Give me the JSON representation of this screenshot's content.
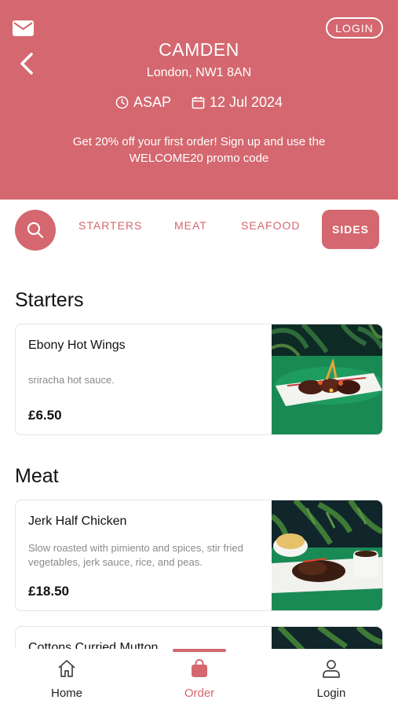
{
  "header": {
    "login_label": "LOGIN",
    "store_name": "CAMDEN",
    "store_address": "London, NW1 8AN",
    "time_label": "ASAP",
    "date_label": "12 Jul 2024",
    "promo_line1": "Get 20% off your first order! Sign up and use the",
    "promo_line2": "WELCOME20 promo code",
    "accent_color": "#d4676f"
  },
  "tabs": [
    {
      "label": "STARTERS"
    },
    {
      "label": "MEAT"
    },
    {
      "label": "SEAFOOD"
    },
    {
      "label": "SIDES",
      "selected": true
    }
  ],
  "sections": [
    {
      "title": "Starters",
      "items": [
        {
          "name": "Ebony Hot Wings",
          "description": "sriracha hot sauce.",
          "price": "£6.50"
        }
      ]
    },
    {
      "title": "Meat",
      "items": [
        {
          "name": "Jerk Half Chicken",
          "description": "Slow roasted with pimiento and spices, stir fried vegetables, jerk sauce, rice, and peas.",
          "price": "£18.50"
        },
        {
          "name": "Cottons Curried Mutton"
        }
      ]
    }
  ],
  "nav": [
    {
      "label": "Home",
      "icon": "home-icon"
    },
    {
      "label": "Order",
      "icon": "bag-icon",
      "active": true
    },
    {
      "label": "Login",
      "icon": "user-icon"
    }
  ]
}
